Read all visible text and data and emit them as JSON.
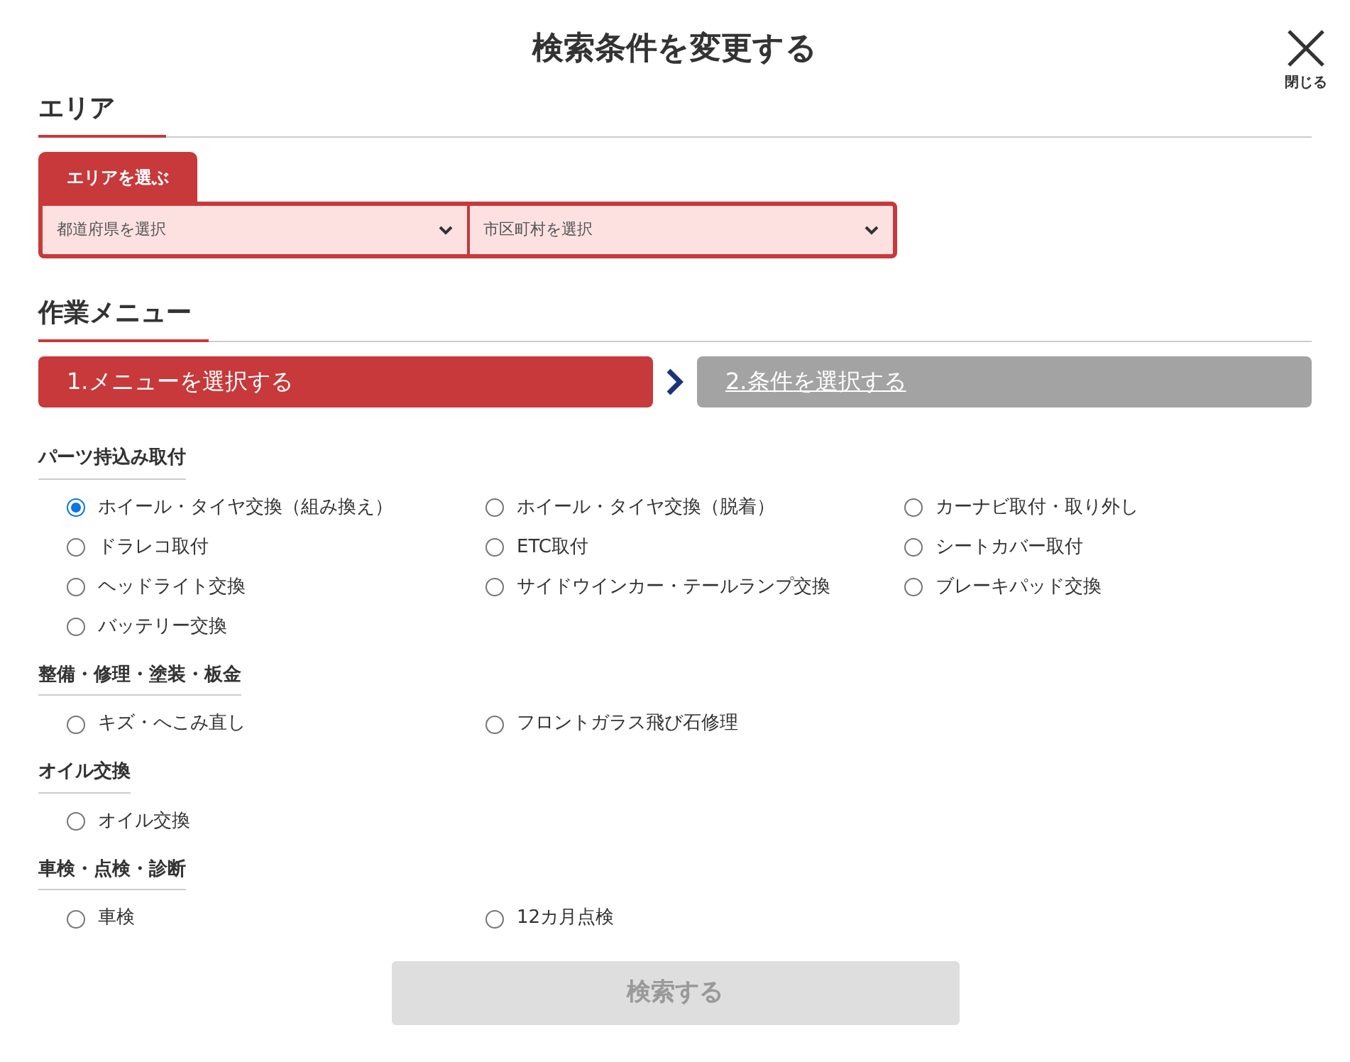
{
  "title": "検索条件を変更する",
  "close": {
    "label": "閉じる"
  },
  "area": {
    "heading": "エリア",
    "tab_label": "エリアを選ぶ",
    "selects": [
      {
        "value": "都道府県を選択"
      },
      {
        "value": "市区町村を選択"
      }
    ]
  },
  "menu": {
    "heading": "作業メニュー",
    "steps": [
      {
        "label": "1.メニューを選択する",
        "selected": true
      },
      {
        "label": "2.条件を選択する",
        "selected": false
      }
    ]
  },
  "categories": [
    {
      "heading": "パーツ持込み取付",
      "options": [
        {
          "label": "ホイール・タイヤ交換（組み換え）",
          "selected": true
        },
        {
          "label": "ホイール・タイヤ交換（脱着）",
          "selected": false
        },
        {
          "label": "カーナビ取付・取り外し",
          "selected": false
        },
        {
          "label": "ドラレコ取付",
          "selected": false
        },
        {
          "label": "ETC取付",
          "selected": false
        },
        {
          "label": "シートカバー取付",
          "selected": false
        },
        {
          "label": "ヘッドライト交換",
          "selected": false
        },
        {
          "label": "サイドウインカー・テールランプ交換",
          "selected": false
        },
        {
          "label": "ブレーキパッド交換",
          "selected": false
        },
        {
          "label": "バッテリー交換",
          "selected": false
        }
      ]
    },
    {
      "heading": "整備・修理・塗装・板金",
      "options": [
        {
          "label": "キズ・へこみ直し",
          "selected": false
        },
        {
          "label": "フロントガラス飛び石修理",
          "selected": false
        }
      ]
    },
    {
      "heading": "オイル交換",
      "options": [
        {
          "label": "オイル交換",
          "selected": false
        }
      ]
    },
    {
      "heading": "車検・点検・診断",
      "options": [
        {
          "label": "車検",
          "selected": false
        },
        {
          "label": "12カ月点検",
          "selected": false
        }
      ]
    }
  ],
  "search_button": {
    "label": "検索する",
    "disabled": true
  }
}
